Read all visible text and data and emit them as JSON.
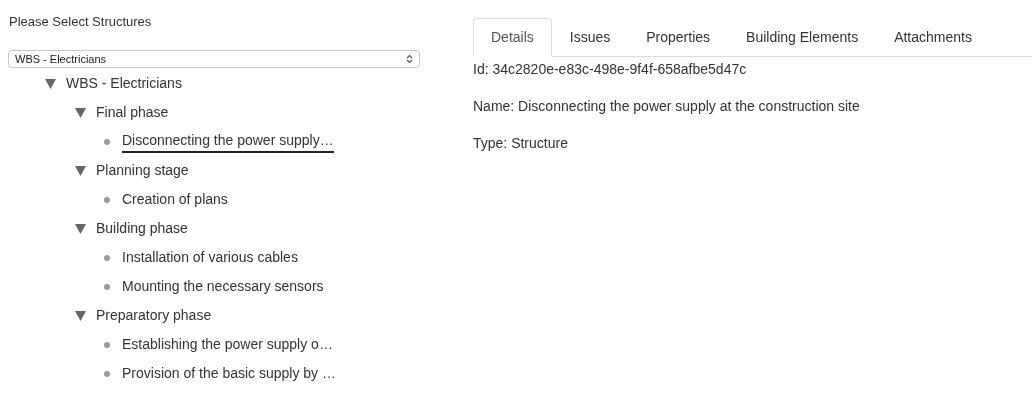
{
  "heading": "Please Select Structures",
  "structure_select": {
    "value": "WBS - Electricians"
  },
  "tree": [
    {
      "label": "WBS - Electricians",
      "expanded": true,
      "selected": false,
      "children": [
        {
          "label": "Final phase",
          "expanded": true,
          "selected": false,
          "children": [
            {
              "label": "Disconnecting the power supply…",
              "selected": true
            }
          ]
        },
        {
          "label": "Planning stage",
          "expanded": true,
          "selected": false,
          "children": [
            {
              "label": "Creation of plans",
              "selected": false
            }
          ]
        },
        {
          "label": "Building phase",
          "expanded": true,
          "selected": false,
          "children": [
            {
              "label": "Installation of various cables",
              "selected": false
            },
            {
              "label": "Mounting the necessary sensors",
              "selected": false
            }
          ]
        },
        {
          "label": "Preparatory phase",
          "expanded": true,
          "selected": false,
          "children": [
            {
              "label": "Establishing the power supply o…",
              "selected": false
            },
            {
              "label": "Provision of the basic supply by …",
              "selected": false
            }
          ]
        }
      ]
    }
  ],
  "tabs": [
    {
      "label": "Details",
      "selected": true
    },
    {
      "label": "Issues",
      "selected": false
    },
    {
      "label": "Properties",
      "selected": false
    },
    {
      "label": "Building Elements",
      "selected": false
    },
    {
      "label": "Attachments",
      "selected": false
    }
  ],
  "details": [
    "Id: 34c2820e-e83c-498e-9f4f-658afbe5d47c",
    "Name: Disconnecting the power supply at the construction site",
    "Type: Structure"
  ]
}
